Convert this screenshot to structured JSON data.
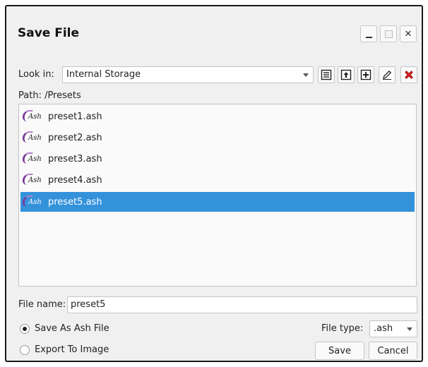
{
  "window": {
    "title": "Save File",
    "minimize_glyph": "",
    "close_glyph": "✕"
  },
  "toolbar": {
    "look_in_label": "Look in:",
    "look_in_value": "Internal Storage",
    "icons": [
      "list-view-icon",
      "parent-folder-icon",
      "new-folder-icon",
      "rename-pencil-icon",
      "delete-icon"
    ]
  },
  "path": {
    "label": "Path: /Presets"
  },
  "files": [
    {
      "name": "preset1.ash",
      "icon_text": "Ash",
      "selected": false
    },
    {
      "name": "preset2.ash",
      "icon_text": "Ash",
      "selected": false
    },
    {
      "name": "preset3.ash",
      "icon_text": "Ash",
      "selected": false
    },
    {
      "name": "preset4.ash",
      "icon_text": "Ash",
      "selected": false
    },
    {
      "name": "preset5.ash",
      "icon_text": "Ash",
      "selected": true
    }
  ],
  "file_name": {
    "label": "File name:",
    "value": "preset5"
  },
  "options": {
    "save_as_ash": "Save As Ash File",
    "export_image": "Export To Image",
    "selected": "save_as_ash"
  },
  "file_type": {
    "label": "File type:",
    "value": ".ash"
  },
  "buttons": {
    "save": "Save",
    "cancel": "Cancel"
  },
  "colors": {
    "selection": "#3492db",
    "delete_red": "#d42020",
    "ash_purple": "#7b3a98"
  }
}
